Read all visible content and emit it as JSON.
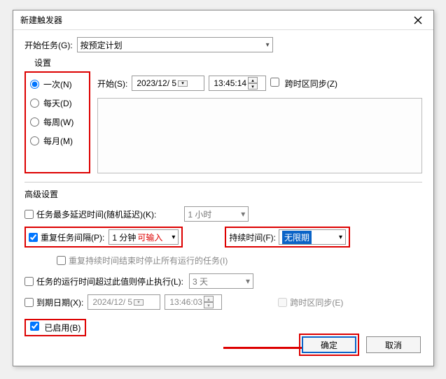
{
  "dialog": {
    "title": "新建触发器"
  },
  "beginTask": {
    "label": "开始任务(G):",
    "value": "按预定计划"
  },
  "settings": {
    "label": "设置",
    "radios": {
      "once": "一次(N)",
      "daily": "每天(D)",
      "weekly": "每周(W)",
      "monthly": "每月(M)"
    },
    "start": {
      "label": "开始(S):",
      "date": "2023/12/ 5",
      "time": "13:45:14",
      "syncTz": "跨时区同步(Z)"
    }
  },
  "advanced": {
    "label": "高级设置",
    "delay": {
      "label": "任务最多延迟时间(随机延迟)(K):",
      "value": "1 小时"
    },
    "repeat": {
      "label": "重复任务间隔(P):",
      "value": "1 分钟",
      "hint": "可输入"
    },
    "duration": {
      "label": "持续时间(F):",
      "value": "无限期"
    },
    "stopAtEnd": "重复持续时间结束时停止所有运行的任务(I)",
    "stopAfter": {
      "label": "任务的运行时间超过此值则停止执行(L):",
      "value": "3 天"
    },
    "expire": {
      "label": "到期日期(X):",
      "date": "2024/12/ 5",
      "time": "13:46:03",
      "syncTz": "跨时区同步(E)"
    },
    "enabled": "已启用(B)"
  },
  "buttons": {
    "ok": "确定",
    "cancel": "取消"
  }
}
